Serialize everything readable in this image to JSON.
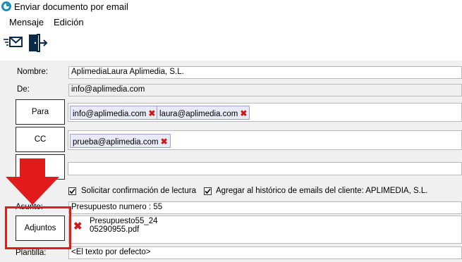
{
  "window": {
    "title": "Enviar documento por email"
  },
  "menu": {
    "items": [
      "Mensaje",
      "Edición"
    ]
  },
  "form": {
    "nombre_label": "Nombre:",
    "nombre_value": "AplimediaLaura Aplimedia, S.L.",
    "de_label": "De:",
    "de_value": "info@aplimedia.com",
    "para_button": "Para",
    "para_recipients": [
      "info@aplimedia.com",
      "laura@aplimedia.com"
    ],
    "cc_button": "CC",
    "cc_recipients": [
      "prueba@aplimedia.com"
    ],
    "bcc_value": "",
    "checkbox_lectura": {
      "label": "Solicitar confirmación de lectura",
      "checked": true
    },
    "checkbox_historico": {
      "label": "Agregar al histórico de emails del cliente: APLIMEDIA, S.L.",
      "checked": true
    },
    "asunto_label": "Asunto:",
    "asunto_value": "Presupuesto numero : 55",
    "adjuntos_button": "Adjuntos",
    "attachment_line1": "Presupuesto55_24",
    "attachment_line2": "05290955.pdf",
    "plantilla_label": "Plantilla:",
    "plantilla_value": "<El texto por defecto>"
  },
  "icons": {
    "app": "app-logo-icon",
    "send": "send-email-icon",
    "exit": "exit-door-icon",
    "remove": "remove-x-icon",
    "arrow": "red-arrow-down-icon"
  },
  "colors": {
    "highlight": "#e11b1b",
    "remove_x": "#cc1a1a",
    "chip_bg": "#e8ebf7",
    "window_bg": "#f0f0f0"
  }
}
